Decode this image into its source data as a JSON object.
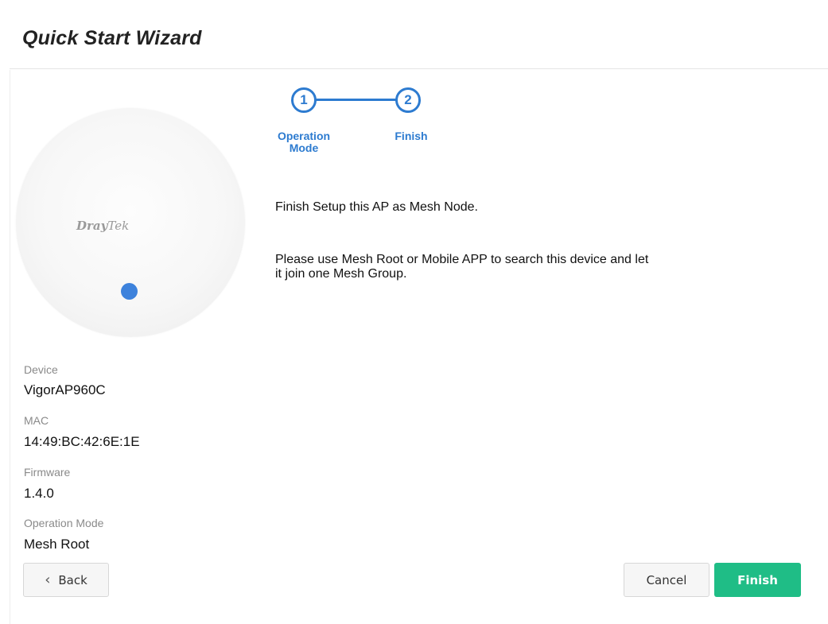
{
  "page": {
    "title": "Quick Start Wizard"
  },
  "stepper": {
    "steps": [
      {
        "number": "1",
        "label": "Operation Mode"
      },
      {
        "number": "2",
        "label": "Finish"
      }
    ]
  },
  "device_image": {
    "brand_bold": "Dray",
    "brand_italic": "Tek"
  },
  "message": {
    "line1": "Finish Setup this AP as Mesh Node.",
    "line2": "Please use Mesh Root or Mobile APP to search this device and let it join one Mesh Group."
  },
  "info": {
    "device_label": "Device",
    "device_value": "VigorAP960C",
    "mac_label": "MAC",
    "mac_value": "14:49:BC:42:6E:1E",
    "firmware_label": "Firmware",
    "firmware_value": "1.4.0",
    "mode_label": "Operation Mode",
    "mode_value": "Mesh Root"
  },
  "buttons": {
    "back": "Back",
    "cancel": "Cancel",
    "finish": "Finish"
  },
  "colors": {
    "step_blue": "#2d7bd0",
    "finish_green": "#1fbd86",
    "led_blue": "#3d82dc"
  }
}
